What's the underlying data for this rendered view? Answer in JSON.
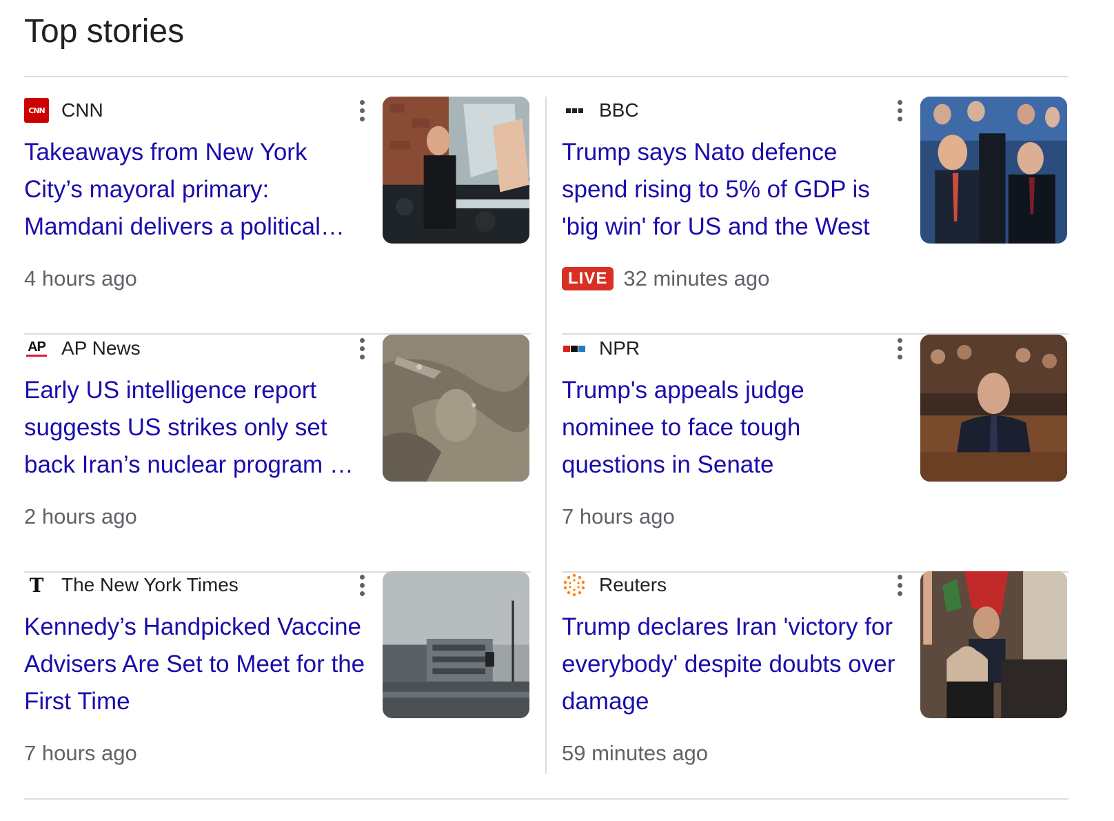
{
  "page": {
    "title": "Top stories"
  },
  "stories": [
    {
      "source": "CNN",
      "headline": "Takeaways from New York City’s mayoral primary: Mamdani delivers a political earthquake",
      "time": "4 hours ago",
      "live": ""
    },
    {
      "source": "BBC",
      "headline": "Trump says Nato defence spend rising to 5% of GDP is 'big win' for US and the West",
      "time": "32 minutes ago",
      "live": "LIVE"
    },
    {
      "source": "AP News",
      "headline": "Early US intelligence report suggests US strikes only set back Iran’s nuclear program by months",
      "time": "2 hours ago",
      "live": ""
    },
    {
      "source": "NPR",
      "headline": "Trump's appeals judge nominee to face tough questions in Senate",
      "time": "7 hours ago",
      "live": ""
    },
    {
      "source": "The New York Times",
      "headline": "Kennedy’s Handpicked Vaccine Advisers Are Set to Meet for the First Time",
      "time": "7 hours ago",
      "live": ""
    },
    {
      "source": "Reuters",
      "headline": "Trump declares Iran 'victory for everybody' despite doubts over damage",
      "time": "59 minutes ago",
      "live": ""
    }
  ],
  "logos": {
    "cnn": {
      "text": "CNN",
      "color": "#cc0000"
    },
    "ap": {
      "text": "AP",
      "underline_color": "#e31837"
    },
    "npr": {
      "text": "npr"
    },
    "nyt": {
      "text": "T"
    }
  },
  "colors": {
    "link": "#1a0dab",
    "meta": "#5f6368",
    "live": "#d93025",
    "divider": "#dadce0"
  }
}
